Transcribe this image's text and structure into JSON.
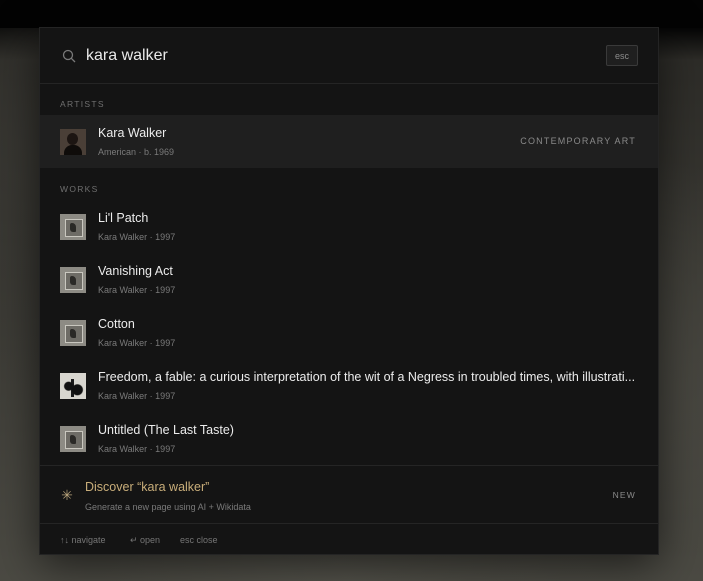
{
  "search": {
    "query": "kara walker",
    "esc_label": "esc"
  },
  "artists": {
    "section_label": "ARTISTS",
    "items": [
      {
        "name": "Kara Walker",
        "subtitle": "American · b. 1969",
        "tag": "CONTEMPORARY ART"
      }
    ]
  },
  "works": {
    "section_label": "WORKS",
    "items": [
      {
        "title": "Li'l Patch",
        "subtitle": "Kara Walker · 1997"
      },
      {
        "title": "Vanishing Act",
        "subtitle": "Kara Walker · 1997"
      },
      {
        "title": "Cotton",
        "subtitle": "Kara Walker · 1997"
      },
      {
        "title": "Freedom, a fable: a curious interpretation of the wit of a Negress in troubled times, with illustrati...",
        "subtitle": "Kara Walker · 1997"
      },
      {
        "title": "Untitled (The Last Taste)",
        "subtitle": "Kara Walker · 1997"
      }
    ]
  },
  "discover": {
    "title": "Discover “kara walker”",
    "subtitle": "Generate a new page using AI + Wikidata",
    "tag": "NEW",
    "icon": "sparkle-icon"
  },
  "footer": {
    "navigate": "↑↓ navigate",
    "open": "↵ open",
    "close": "esc close"
  },
  "colors": {
    "panel": "#141414",
    "selected_row": "#1f1f1f",
    "accent": "#c9ae7a"
  }
}
